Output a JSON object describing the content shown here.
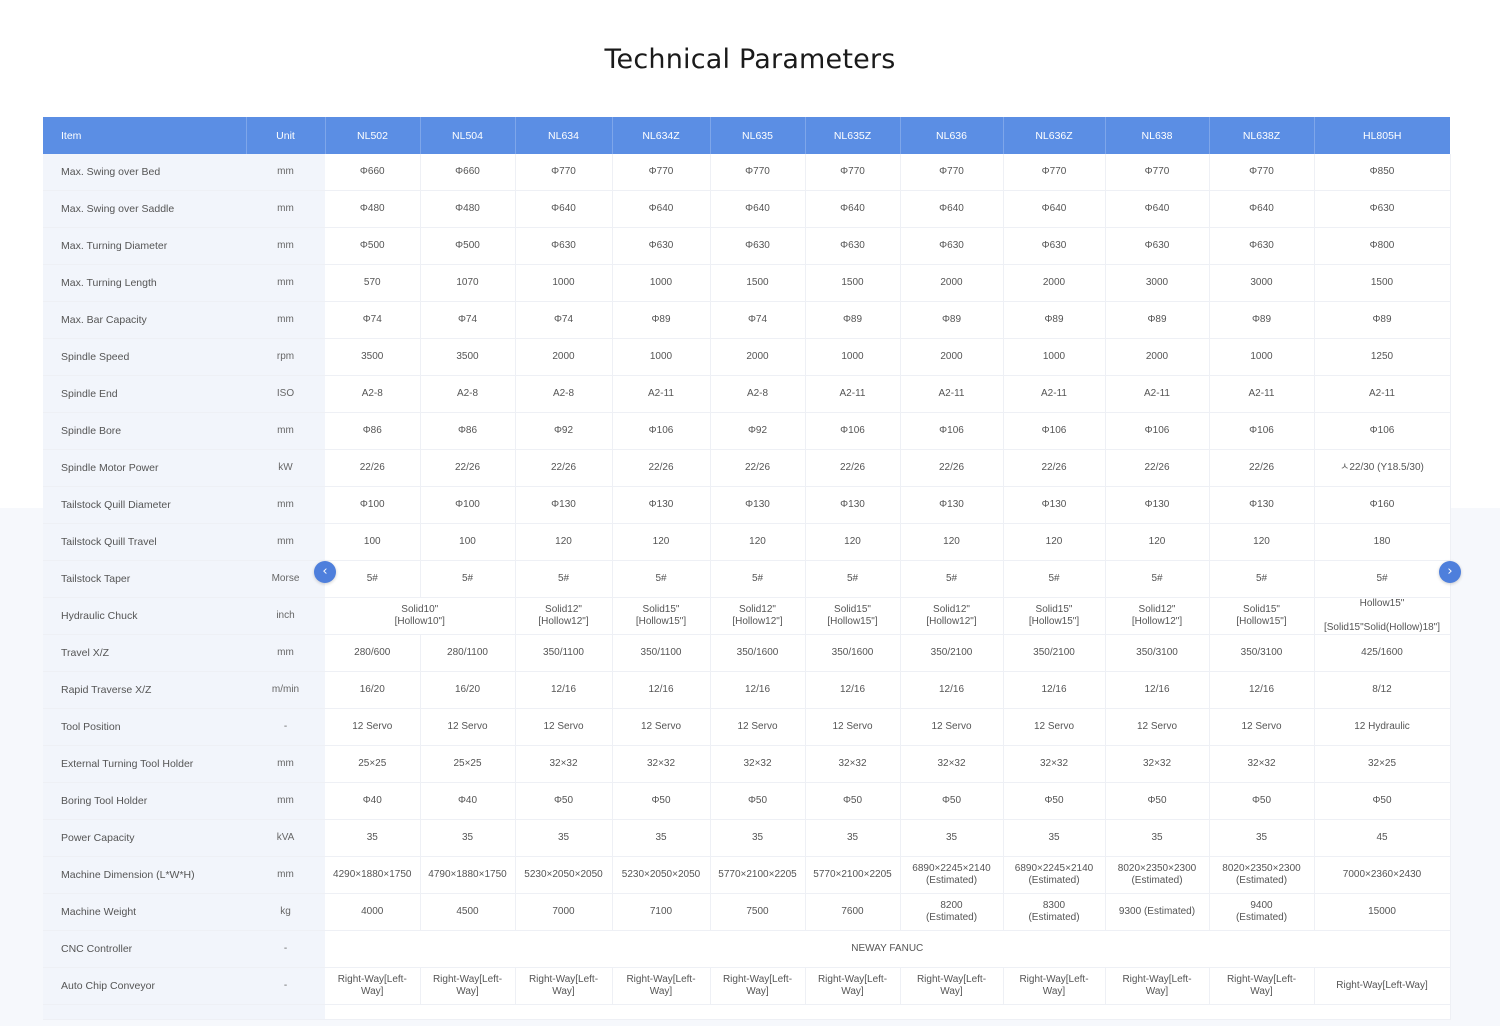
{
  "title": "Technical Parameters",
  "colors": {
    "header_bg": "#5b8ee4",
    "nav_button": "#4e7fdc",
    "stub_bg": "#f2f5fb"
  },
  "nav": {
    "prev_icon": "chevron-left-icon",
    "next_icon": "chevron-right-icon",
    "prev_glyph": "‹",
    "next_glyph": "›"
  },
  "table": {
    "item_header": "Item",
    "unit_header": "Unit",
    "models": [
      "NL502",
      "NL504",
      "NL634",
      "NL634Z",
      "NL635",
      "NL635Z",
      "NL636",
      "NL636Z",
      "NL638",
      "NL638Z",
      "HL805H"
    ],
    "rows": [
      {
        "item": "Max. Swing over Bed",
        "unit": "mm",
        "cells": [
          {
            "v": "Φ660"
          },
          {
            "v": "Φ660"
          },
          {
            "v": "Φ770"
          },
          {
            "v": "Φ770"
          },
          {
            "v": "Φ770"
          },
          {
            "v": "Φ770"
          },
          {
            "v": "Φ770"
          },
          {
            "v": "Φ770"
          },
          {
            "v": "Φ770"
          },
          {
            "v": "Φ770"
          },
          {
            "v": "Φ850"
          }
        ]
      },
      {
        "item": "Max. Swing over Saddle",
        "unit": "mm",
        "cells": [
          {
            "v": "Φ480"
          },
          {
            "v": "Φ480"
          },
          {
            "v": "Φ640"
          },
          {
            "v": "Φ640"
          },
          {
            "v": "Φ640"
          },
          {
            "v": "Φ640"
          },
          {
            "v": "Φ640"
          },
          {
            "v": "Φ640"
          },
          {
            "v": "Φ640"
          },
          {
            "v": "Φ640"
          },
          {
            "v": "Φ630"
          }
        ]
      },
      {
        "item": "Max. Turning Diameter",
        "unit": "mm",
        "cells": [
          {
            "v": "Φ500"
          },
          {
            "v": "Φ500"
          },
          {
            "v": "Φ630"
          },
          {
            "v": "Φ630"
          },
          {
            "v": "Φ630"
          },
          {
            "v": "Φ630"
          },
          {
            "v": "Φ630"
          },
          {
            "v": "Φ630"
          },
          {
            "v": "Φ630"
          },
          {
            "v": "Φ630"
          },
          {
            "v": "Φ800"
          }
        ]
      },
      {
        "item": "Max. Turning Length",
        "unit": "mm",
        "cells": [
          {
            "v": "570"
          },
          {
            "v": "1070"
          },
          {
            "v": "1000"
          },
          {
            "v": "1000"
          },
          {
            "v": "1500"
          },
          {
            "v": "1500"
          },
          {
            "v": "2000"
          },
          {
            "v": "2000"
          },
          {
            "v": "3000"
          },
          {
            "v": "3000"
          },
          {
            "v": "1500"
          }
        ]
      },
      {
        "item": "Max. Bar Capacity",
        "unit": "mm",
        "cells": [
          {
            "v": "Φ74"
          },
          {
            "v": "Φ74"
          },
          {
            "v": "Φ74"
          },
          {
            "v": "Φ89"
          },
          {
            "v": "Φ74"
          },
          {
            "v": "Φ89"
          },
          {
            "v": "Φ89"
          },
          {
            "v": "Φ89"
          },
          {
            "v": "Φ89"
          },
          {
            "v": "Φ89"
          },
          {
            "v": "Φ89"
          }
        ]
      },
      {
        "item": "Spindle Speed",
        "unit": "rpm",
        "cells": [
          {
            "v": "3500"
          },
          {
            "v": "3500"
          },
          {
            "v": "2000"
          },
          {
            "v": "1000"
          },
          {
            "v": "2000"
          },
          {
            "v": "1000"
          },
          {
            "v": "2000"
          },
          {
            "v": "1000"
          },
          {
            "v": "2000"
          },
          {
            "v": "1000"
          },
          {
            "v": "1250"
          }
        ]
      },
      {
        "item": "Spindle End",
        "unit": "ISO",
        "cells": [
          {
            "v": "A2-8"
          },
          {
            "v": "A2-8"
          },
          {
            "v": "A2-8"
          },
          {
            "v": "A2-11"
          },
          {
            "v": "A2-8"
          },
          {
            "v": "A2-11"
          },
          {
            "v": "A2-11"
          },
          {
            "v": "A2-11"
          },
          {
            "v": "A2-11"
          },
          {
            "v": "A2-11"
          },
          {
            "v": "A2-11"
          }
        ]
      },
      {
        "item": "Spindle Bore",
        "unit": "mm",
        "cells": [
          {
            "v": "Φ86"
          },
          {
            "v": "Φ86"
          },
          {
            "v": "Φ92"
          },
          {
            "v": "Φ106"
          },
          {
            "v": "Φ92"
          },
          {
            "v": "Φ106"
          },
          {
            "v": "Φ106"
          },
          {
            "v": "Φ106"
          },
          {
            "v": "Φ106"
          },
          {
            "v": "Φ106"
          },
          {
            "v": "Φ106"
          }
        ]
      },
      {
        "item": "Spindle Motor Power",
        "unit": "kW",
        "cells": [
          {
            "v": "22/26"
          },
          {
            "v": "22/26"
          },
          {
            "v": "22/26"
          },
          {
            "v": "22/26"
          },
          {
            "v": "22/26"
          },
          {
            "v": "22/26"
          },
          {
            "v": "22/26"
          },
          {
            "v": "22/26"
          },
          {
            "v": "22/26"
          },
          {
            "v": "22/26"
          },
          {
            "v": "ㅅ22/30  (Y18.5/30)"
          }
        ]
      },
      {
        "item": "Tailstock Quill Diameter",
        "unit": "mm",
        "cells": [
          {
            "v": "Φ100"
          },
          {
            "v": "Φ100"
          },
          {
            "v": "Φ130"
          },
          {
            "v": "Φ130"
          },
          {
            "v": "Φ130"
          },
          {
            "v": "Φ130"
          },
          {
            "v": "Φ130"
          },
          {
            "v": "Φ130"
          },
          {
            "v": "Φ130"
          },
          {
            "v": "Φ130"
          },
          {
            "v": "Φ160"
          }
        ]
      },
      {
        "item": "Tailstock Quill Travel",
        "unit": "mm",
        "cells": [
          {
            "v": "100"
          },
          {
            "v": "100"
          },
          {
            "v": "120"
          },
          {
            "v": "120"
          },
          {
            "v": "120"
          },
          {
            "v": "120"
          },
          {
            "v": "120"
          },
          {
            "v": "120"
          },
          {
            "v": "120"
          },
          {
            "v": "120"
          },
          {
            "v": "180"
          }
        ]
      },
      {
        "item": "Tailstock Taper",
        "unit": "Morse",
        "cells": [
          {
            "v": "5#"
          },
          {
            "v": "5#"
          },
          {
            "v": "5#"
          },
          {
            "v": "5#"
          },
          {
            "v": "5#"
          },
          {
            "v": "5#"
          },
          {
            "v": "5#"
          },
          {
            "v": "5#"
          },
          {
            "v": "5#"
          },
          {
            "v": "5#"
          },
          {
            "v": "5#"
          }
        ]
      },
      {
        "item": "Hydraulic Chuck",
        "unit": "inch",
        "cells": [
          {
            "v": "Solid10\"\n[Hollow10\"]",
            "span": 2
          },
          {
            "v": "Solid12\"\n[Hollow12\"]"
          },
          {
            "v": "Solid15\"\n[Hollow15\"]"
          },
          {
            "v": "Solid12\"\n[Hollow12\"]"
          },
          {
            "v": "Solid15\"\n[Hollow15\"]"
          },
          {
            "v": "Solid12\"\n[Hollow12\"]"
          },
          {
            "v": "Solid15\"\n[Hollow15\"]"
          },
          {
            "v": "Solid12\"\n[Hollow12\"]"
          },
          {
            "v": "Solid15\"\n[Hollow15\"]"
          },
          {
            "v": "Hollow15\"\n\n[Solid15\"Solid(Hollow)18\"]"
          }
        ]
      },
      {
        "item": "Travel X/Z",
        "unit": "mm",
        "cells": [
          {
            "v": "280/600"
          },
          {
            "v": "280/1100"
          },
          {
            "v": "350/1100"
          },
          {
            "v": "350/1100"
          },
          {
            "v": "350/1600"
          },
          {
            "v": "350/1600"
          },
          {
            "v": "350/2100"
          },
          {
            "v": "350/2100"
          },
          {
            "v": "350/3100"
          },
          {
            "v": "350/3100"
          },
          {
            "v": "425/1600"
          }
        ]
      },
      {
        "item": "Rapid Traverse X/Z",
        "unit": "m/min",
        "cells": [
          {
            "v": "16/20"
          },
          {
            "v": "16/20"
          },
          {
            "v": "12/16"
          },
          {
            "v": "12/16"
          },
          {
            "v": "12/16"
          },
          {
            "v": "12/16"
          },
          {
            "v": "12/16"
          },
          {
            "v": "12/16"
          },
          {
            "v": "12/16"
          },
          {
            "v": "12/16"
          },
          {
            "v": "8/12"
          }
        ]
      },
      {
        "item": "Tool Position",
        "unit": "-",
        "cells": [
          {
            "v": "12   Servo"
          },
          {
            "v": "12   Servo"
          },
          {
            "v": "12   Servo"
          },
          {
            "v": "12   Servo"
          },
          {
            "v": "12   Servo"
          },
          {
            "v": "12   Servo"
          },
          {
            "v": "12   Servo"
          },
          {
            "v": "12   Servo"
          },
          {
            "v": "12   Servo"
          },
          {
            "v": "12   Servo"
          },
          {
            "v": "12   Hydraulic"
          }
        ]
      },
      {
        "item": "External Turning Tool Holder",
        "unit": "mm",
        "cells": [
          {
            "v": "25×25"
          },
          {
            "v": "25×25"
          },
          {
            "v": "32×32"
          },
          {
            "v": "32×32"
          },
          {
            "v": "32×32"
          },
          {
            "v": "32×32"
          },
          {
            "v": "32×32"
          },
          {
            "v": "32×32"
          },
          {
            "v": "32×32"
          },
          {
            "v": "32×32"
          },
          {
            "v": "32×25"
          }
        ]
      },
      {
        "item": "Boring Tool Holder",
        "unit": "mm",
        "cells": [
          {
            "v": "Φ40"
          },
          {
            "v": "Φ40"
          },
          {
            "v": "Φ50"
          },
          {
            "v": "Φ50"
          },
          {
            "v": "Φ50"
          },
          {
            "v": "Φ50"
          },
          {
            "v": "Φ50"
          },
          {
            "v": "Φ50"
          },
          {
            "v": "Φ50"
          },
          {
            "v": "Φ50"
          },
          {
            "v": "Φ50"
          }
        ]
      },
      {
        "item": "Power Capacity",
        "unit": "kVA",
        "cells": [
          {
            "v": "35"
          },
          {
            "v": "35"
          },
          {
            "v": "35"
          },
          {
            "v": "35"
          },
          {
            "v": "35"
          },
          {
            "v": "35"
          },
          {
            "v": "35"
          },
          {
            "v": "35"
          },
          {
            "v": "35"
          },
          {
            "v": "35"
          },
          {
            "v": "45"
          }
        ]
      },
      {
        "item": "Machine Dimension (L*W*H)",
        "unit": "mm",
        "cells": [
          {
            "v": "4290×1880×1750"
          },
          {
            "v": "4790×1880×1750"
          },
          {
            "v": "5230×2050×2050"
          },
          {
            "v": "5230×2050×2050"
          },
          {
            "v": "5770×2100×2205"
          },
          {
            "v": "5770×2100×2205"
          },
          {
            "v": "6890×2245×2140\n(Estimated)"
          },
          {
            "v": "6890×2245×2140\n(Estimated)"
          },
          {
            "v": "8020×2350×2300\n(Estimated)"
          },
          {
            "v": "8020×2350×2300\n(Estimated)"
          },
          {
            "v": "7000×2360×2430"
          }
        ]
      },
      {
        "item": "Machine Weight",
        "unit": "kg",
        "cells": [
          {
            "v": "4000"
          },
          {
            "v": "4500"
          },
          {
            "v": "7000"
          },
          {
            "v": "7100"
          },
          {
            "v": "7500"
          },
          {
            "v": "7600"
          },
          {
            "v": "8200\n(Estimated)"
          },
          {
            "v": "8300\n(Estimated)"
          },
          {
            "v": "9300   (Estimated)"
          },
          {
            "v": "9400\n(Estimated)"
          },
          {
            "v": "15000"
          }
        ]
      },
      {
        "item": "CNC Controller",
        "unit": "-",
        "cells": [
          {
            "v": "NEWAY   FANUC",
            "span": 11
          }
        ]
      },
      {
        "item": "Auto Chip Conveyor",
        "unit": "-",
        "cells": [
          {
            "v": "Right-Way[Left-\nWay]"
          },
          {
            "v": "Right-Way[Left-\nWay]"
          },
          {
            "v": "Right-Way[Left-\nWay]"
          },
          {
            "v": "Right-Way[Left-\nWay]"
          },
          {
            "v": "Right-Way[Left-\nWay]"
          },
          {
            "v": "Right-Way[Left-\nWay]"
          },
          {
            "v": "Right-Way[Left-\nWay]"
          },
          {
            "v": "Right-Way[Left-\nWay]"
          },
          {
            "v": "Right-Way[Left-\nWay]"
          },
          {
            "v": "Right-Way[Left-\nWay]"
          },
          {
            "v": "Right-Way[Left-Way]"
          }
        ]
      }
    ]
  }
}
